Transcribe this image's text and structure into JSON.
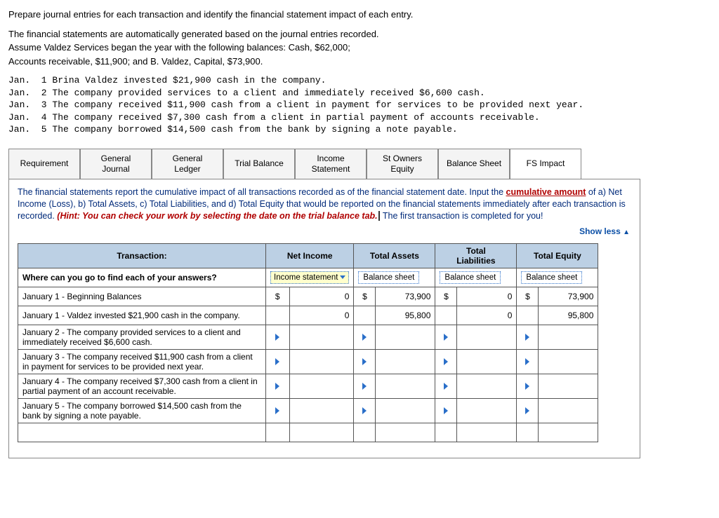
{
  "intro": {
    "line1": "Prepare journal entries for each transaction and identify the financial statement impact of each entry.",
    "line2": "The financial statements are automatically generated based on the journal entries recorded.",
    "line3": "Assume Valdez Services began the year with the following balances:  Cash, $62,000;",
    "line4": "Accounts receivable, $11,900; and B. Valdez, Capital, $73,900."
  },
  "journal_text": "Jan.  1 Brina Valdez invested $21,900 cash in the company.\nJan.  2 The company provided services to a client and immediately received $6,600 cash.\nJan.  3 The company received $11,900 cash from a client in payment for services to be provided next year.\nJan.  4 The company received $7,300 cash from a client in partial payment of accounts receivable.\nJan.  5 The company borrowed $14,500 cash from the bank by signing a note payable.",
  "tabs": {
    "req": "Requirement",
    "gj": "General\nJournal",
    "gl": "General\nLedger",
    "tb": "Trial Balance",
    "is": "Income\nStatement",
    "soe": "St Owners\nEquity",
    "bs": "Balance Sheet",
    "fsi": "FS Impact"
  },
  "desc": {
    "p1a": "The financial statements report the cumulative impact of all transactions recorded as of the financial statement date.   Input the ",
    "cumu": "cumulative amount",
    "p1b": " of a) Net Income (Loss), b)  Total Assets, c) Total Liabilities, and d)  Total Equity that would be reported on the financial statements immediately after each transaction is recorded.  ",
    "hint": "(Hint:  You can check your work by selecting the date on the trial balance tab.",
    "p1c": " The first transaction is completed for you!"
  },
  "showless": "Show less",
  "table": {
    "headers": {
      "txn": "Transaction:",
      "ni": "Net Income",
      "ta": "Total Assets",
      "tl": "Total\nLiabilities",
      "te": "Total Equity"
    },
    "answer_row": {
      "question": "Where can you go to find each of your answers?",
      "ni": "Income statement",
      "ta": "Balance sheet",
      "tl": "Balance sheet",
      "te": "Balance sheet"
    },
    "rows": [
      {
        "txn": "January 1 -  Beginning Balances",
        "ni_cur": "$",
        "ni": "0",
        "ta_cur": "$",
        "ta": "73,900",
        "tl_cur": "$",
        "tl": "0",
        "te_cur": "$",
        "te": "73,900"
      },
      {
        "txn": "January 1 -  Valdez invested $21,900 cash in the company.",
        "ni_cur": "",
        "ni": "0",
        "ta_cur": "",
        "ta": "95,800",
        "tl_cur": "",
        "tl": "0",
        "te_cur": "",
        "te": "95,800"
      },
      {
        "txn": "January 2 - The company provided services to a client and immediately received $6,600 cash.",
        "ni_cur": "",
        "ni": "",
        "ta_cur": "",
        "ta": "",
        "tl_cur": "",
        "tl": "",
        "te_cur": "",
        "te": ""
      },
      {
        "txn": "January 3 - The company received $11,900 cash from a client in payment for services to be provided next year.",
        "ni_cur": "",
        "ni": "",
        "ta_cur": "",
        "ta": "",
        "tl_cur": "",
        "tl": "",
        "te_cur": "",
        "te": ""
      },
      {
        "txn": "January 4 - The company received $7,300 cash from a client in partial payment of an account receivable.",
        "ni_cur": "",
        "ni": "",
        "ta_cur": "",
        "ta": "",
        "tl_cur": "",
        "tl": "",
        "te_cur": "",
        "te": ""
      },
      {
        "txn": "January 5 - The company borrowed $14,500 cash from the bank by signing a note payable.",
        "ni_cur": "",
        "ni": "",
        "ta_cur": "",
        "ta": "",
        "tl_cur": "",
        "tl": "",
        "te_cur": "",
        "te": ""
      }
    ]
  }
}
